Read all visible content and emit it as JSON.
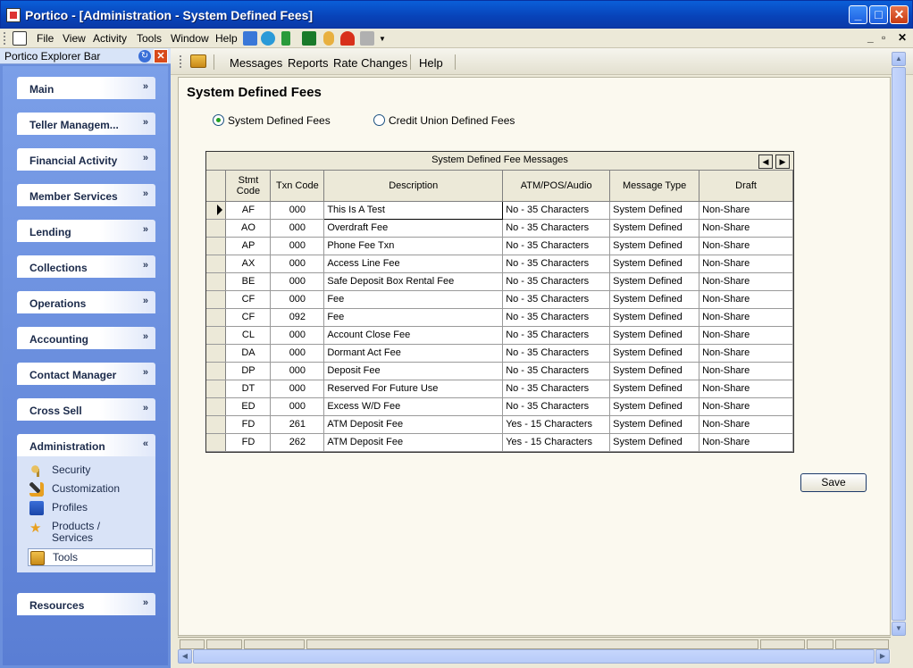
{
  "window": {
    "title": "Portico - [Administration - System Defined Fees]"
  },
  "menu": [
    {
      "label": "File",
      "key": "F"
    },
    {
      "label": "View",
      "key": "V"
    },
    {
      "label": "Activity",
      "key": "A"
    },
    {
      "label": "Tools",
      "key": "T"
    },
    {
      "label": "Window",
      "key": "W"
    },
    {
      "label": "Help",
      "key": "H"
    }
  ],
  "explorer": {
    "title": "Portico Explorer Bar",
    "groups": [
      {
        "label": "Main"
      },
      {
        "label": "Teller Managem..."
      },
      {
        "label": "Financial Activity"
      },
      {
        "label": "Member Services"
      },
      {
        "label": "Lending"
      },
      {
        "label": "Collections"
      },
      {
        "label": "Operations"
      },
      {
        "label": "Accounting"
      },
      {
        "label": "Contact Manager"
      },
      {
        "label": "Cross Sell"
      },
      {
        "label": "Administration"
      },
      {
        "label": "Resources"
      }
    ],
    "admin_items": [
      {
        "label": "Security",
        "icon": "key-icon"
      },
      {
        "label": "Customization",
        "icon": "wrench-icon"
      },
      {
        "label": "Profiles",
        "icon": "profiles-icon"
      },
      {
        "label": "Products / Services",
        "icon": "star-icon"
      },
      {
        "label": "Tools",
        "icon": "toolbox-icon"
      }
    ]
  },
  "toolbar": {
    "items": [
      "Messages",
      "Reports",
      "Rate Changes",
      "Help"
    ]
  },
  "page": {
    "title": "System Defined Fees",
    "radio_system": "System Defined Fees",
    "radio_credit_union": "Credit Union Defined Fees",
    "grid_caption": "System Defined Fee Messages",
    "save_label": "Save"
  },
  "grid": {
    "columns": [
      "Stmt Code",
      "Txn Code",
      "Description",
      "ATM/POS/Audio",
      "Message Type",
      "Draft"
    ],
    "rows": [
      [
        "AF",
        "000",
        "This Is A Test",
        "No - 35 Characters",
        "System Defined",
        "Non-Share"
      ],
      [
        "AO",
        "000",
        "Overdraft Fee",
        "No - 35 Characters",
        "System Defined",
        "Non-Share"
      ],
      [
        "AP",
        "000",
        "Phone Fee Txn",
        "No - 35 Characters",
        "System Defined",
        "Non-Share"
      ],
      [
        "AX",
        "000",
        "Access Line Fee",
        "No - 35 Characters",
        "System Defined",
        "Non-Share"
      ],
      [
        "BE",
        "000",
        "Safe Deposit Box Rental Fee",
        "No - 35 Characters",
        "System Defined",
        "Non-Share"
      ],
      [
        "CF",
        "000",
        "Fee",
        "No - 35 Characters",
        "System Defined",
        "Non-Share"
      ],
      [
        "CF",
        "092",
        "Fee",
        "No - 35 Characters",
        "System Defined",
        "Non-Share"
      ],
      [
        "CL",
        "000",
        "Account Close Fee",
        "No - 35 Characters",
        "System Defined",
        "Non-Share"
      ],
      [
        "DA",
        "000",
        "Dormant Act Fee",
        "No - 35 Characters",
        "System Defined",
        "Non-Share"
      ],
      [
        "DP",
        "000",
        "Deposit Fee",
        "No - 35 Characters",
        "System Defined",
        "Non-Share"
      ],
      [
        "DT",
        "000",
        "Reserved For Future Use",
        "No - 35 Characters",
        "System Defined",
        "Non-Share"
      ],
      [
        "ED",
        "000",
        "Excess W/D Fee",
        "No - 35 Characters",
        "System Defined",
        "Non-Share"
      ],
      [
        "FD",
        "261",
        "ATM Deposit Fee",
        "Yes - 15 Characters",
        "System Defined",
        "Non-Share"
      ],
      [
        "FD",
        "262",
        "ATM Deposit Fee",
        "Yes - 15 Characters",
        "System Defined",
        "Non-Share"
      ]
    ]
  },
  "colors": {
    "accent": "#0a5fd8",
    "explorer_bg": "#6b8fdc",
    "content_bg": "#fbf9ef"
  }
}
